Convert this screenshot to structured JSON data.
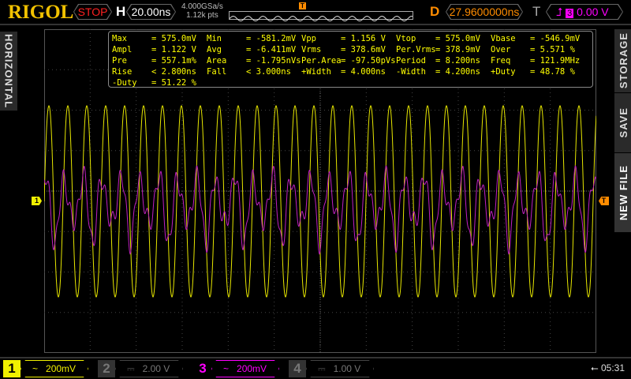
{
  "header": {
    "logo": "RIGOL",
    "run_state": "STOP",
    "h_label": "H",
    "timebase": "20.00ns",
    "sample_rate": "4.000GSa/s",
    "memory_depth": "1.12k pts",
    "d_label": "D",
    "delay": "27.9600000ns",
    "t_label": "T",
    "trigger_source": "3",
    "trigger_level": "0.00 V",
    "trigger_marker": "T"
  },
  "side": {
    "left_tab": "HORIZONTAL",
    "right_tabs": [
      "STORAGE",
      "SAVE",
      "NEW FILE"
    ]
  },
  "measurements": [
    [
      [
        "Max",
        "= 575.0mV"
      ],
      [
        "Min",
        "= -581.2mV"
      ],
      [
        "Vpp",
        "= 1.156 V"
      ],
      [
        "Vtop",
        "= 575.0mV"
      ],
      [
        "Vbase",
        "= -546.9mV"
      ]
    ],
    [
      [
        "Ampl",
        "= 1.122 V"
      ],
      [
        "Avg",
        "= -6.411mV"
      ],
      [
        "Vrms",
        "= 378.6mV"
      ],
      [
        "Per.Vrms",
        "= 378.9mV"
      ],
      [
        "Over",
        "= 5.571 %"
      ]
    ],
    [
      [
        "Pre",
        "= 557.1m%"
      ],
      [
        "Area",
        "= -1.795nVs"
      ],
      [
        "Per.Area",
        "= -97.50pVs"
      ],
      [
        "Period",
        "= 8.200ns"
      ],
      [
        "Freq",
        "= 121.9MHz"
      ]
    ],
    [
      [
        "Rise",
        "< 2.800ns"
      ],
      [
        "Fall",
        "< 3.000ns"
      ],
      [
        "+Width",
        "= 4.000ns"
      ],
      [
        "-Width",
        "= 4.200ns"
      ],
      [
        "+Duty",
        "= 48.78 %"
      ]
    ],
    [
      [
        "-Duty",
        "= 51.22 %"
      ]
    ]
  ],
  "markers": {
    "ch1": "1",
    "trigger": "T"
  },
  "channels": [
    {
      "num": "1",
      "coupling": "~",
      "scale": "200mV",
      "active": true,
      "color": "#f0f000"
    },
    {
      "num": "2",
      "coupling": "⎓",
      "scale": "2.00 V",
      "active": false,
      "color": "#666666"
    },
    {
      "num": "3",
      "coupling": "~",
      "scale": "200mV",
      "active": true,
      "color": "#ff00ff"
    },
    {
      "num": "4",
      "coupling": "⎓",
      "scale": "1.00 V",
      "active": false,
      "color": "#666666"
    }
  ],
  "status": {
    "usb_icon": "usb-icon",
    "clock": "05:31"
  },
  "colors": {
    "ch1": "#e6e600",
    "ch3": "#c020c0",
    "accent": "#ff8c00"
  }
}
